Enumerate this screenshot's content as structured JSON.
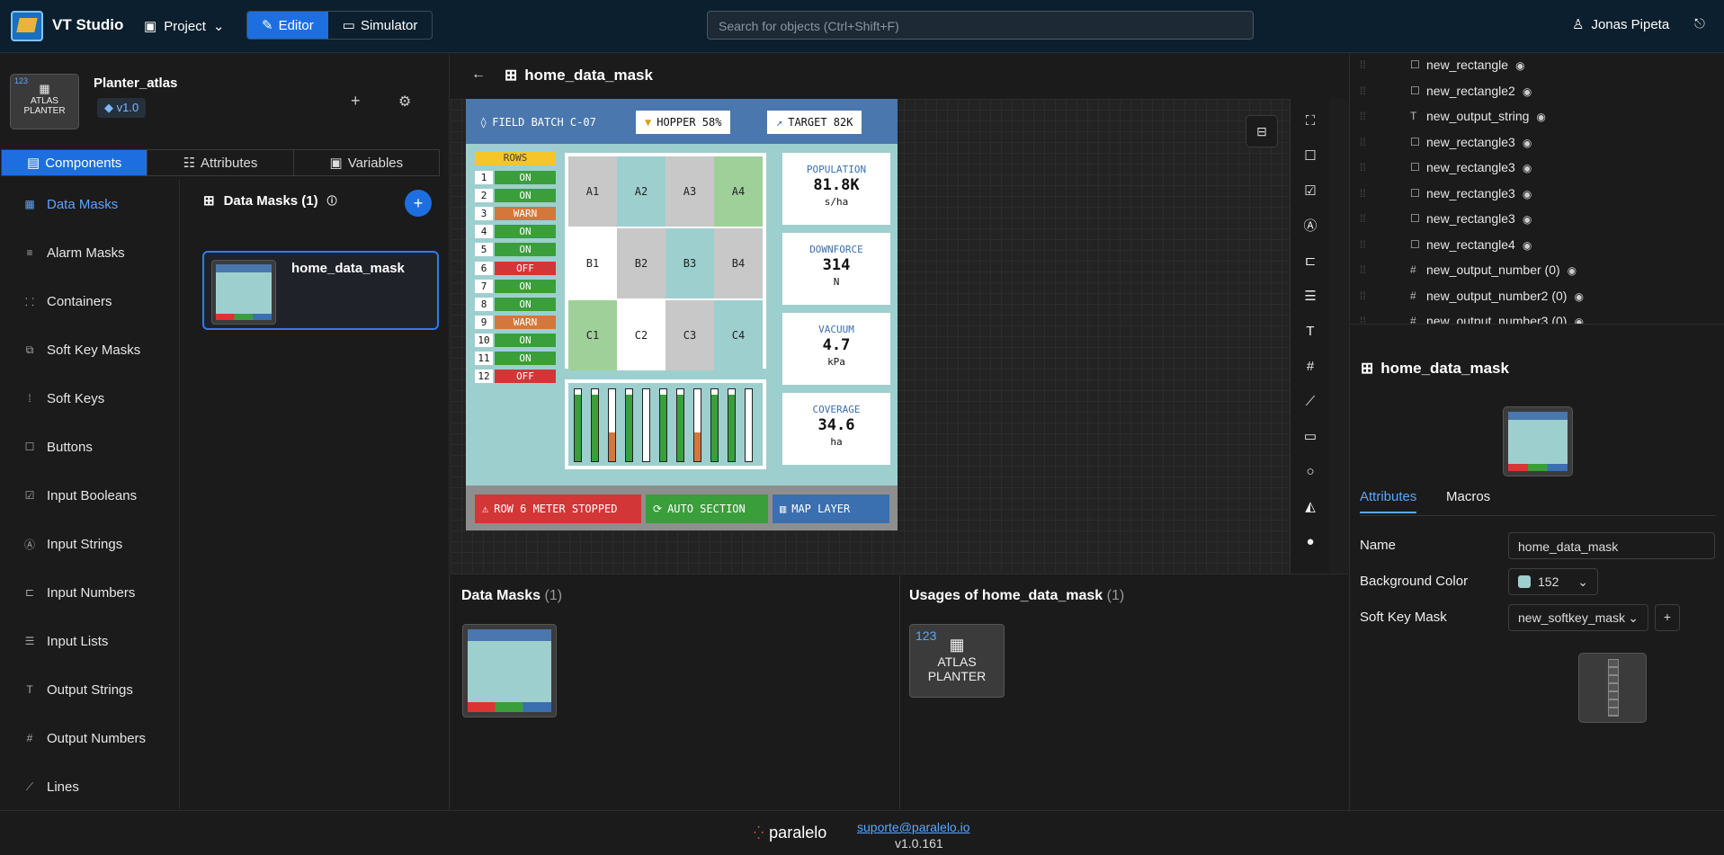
{
  "app": {
    "title": "VT Studio",
    "project_menu": "Project",
    "mode_editor": "Editor",
    "mode_simulator": "Simulator",
    "search_placeholder": "Search for objects (Ctrl+Shift+F)",
    "user": "Jonas Pipeta"
  },
  "project": {
    "name": "Planter_atlas",
    "version": "v1.0",
    "card_number": "123",
    "card_label_1": "ATLAS",
    "card_label_2": "PLANTER"
  },
  "left_tabs": [
    "Components",
    "Attributes",
    "Variables"
  ],
  "nav": [
    "Data Masks",
    "Alarm Masks",
    "Containers",
    "Soft Key Masks",
    "Soft Keys",
    "Buttons",
    "Input Booleans",
    "Input Strings",
    "Input Numbers",
    "Input Lists",
    "Output Strings",
    "Output Numbers",
    "Lines"
  ],
  "nav_icons": [
    "▦",
    "≡",
    "⸬",
    "⧉",
    "⁞",
    "☐",
    "☑",
    "Ⓐ",
    "⊏",
    "☰",
    "T",
    "#",
    "⟋"
  ],
  "list": {
    "heading": "Data Masks (1)",
    "item": "home_data_mask"
  },
  "center": {
    "title": "home_data_mask"
  },
  "vt": {
    "header": [
      "FIELD BATCH C-07",
      "HOPPER 58%",
      "TARGET 82K"
    ],
    "rows_title": "ROWS",
    "rows": [
      {
        "n": "1",
        "s": "ON"
      },
      {
        "n": "2",
        "s": "ON"
      },
      {
        "n": "3",
        "s": "WARN"
      },
      {
        "n": "4",
        "s": "ON"
      },
      {
        "n": "5",
        "s": "ON"
      },
      {
        "n": "6",
        "s": "OFF"
      },
      {
        "n": "7",
        "s": "ON"
      },
      {
        "n": "8",
        "s": "ON"
      },
      {
        "n": "9",
        "s": "WARN"
      },
      {
        "n": "10",
        "s": "ON"
      },
      {
        "n": "11",
        "s": "ON"
      },
      {
        "n": "12",
        "s": "OFF"
      }
    ],
    "status_colors": {
      "ON": "#3a9e3a",
      "WARN": "#d4773a",
      "OFF": "#d33636"
    },
    "cells": [
      {
        "id": "A1",
        "c": "#c8c8c8"
      },
      {
        "id": "A2",
        "c": "#9ecfcf"
      },
      {
        "id": "A3",
        "c": "#c8c8c8"
      },
      {
        "id": "A4",
        "c": "#9fd09a"
      },
      {
        "id": "B1",
        "c": "#ffffff"
      },
      {
        "id": "B2",
        "c": "#c8c8c8"
      },
      {
        "id": "B3",
        "c": "#9ecfcf"
      },
      {
        "id": "B4",
        "c": "#c8c8c8"
      },
      {
        "id": "C1",
        "c": "#9fd09a"
      },
      {
        "id": "C2",
        "c": "#ffffff"
      },
      {
        "id": "C3",
        "c": "#c8c8c8"
      },
      {
        "id": "C4",
        "c": "#9ecfcf"
      }
    ],
    "bar_levels": [
      0.92,
      0.92,
      0.4,
      0.92,
      0,
      0.92,
      0.92,
      0.4,
      0.92,
      0.92,
      0
    ],
    "bar_colors": [
      "#3a9e3a",
      "#3a9e3a",
      "#d4773a",
      "#3a9e3a",
      "#3a9e3a",
      "#3a9e3a",
      "#3a9e3a",
      "#d4773a",
      "#3a9e3a",
      "#3a9e3a",
      "#3a9e3a"
    ],
    "stats": [
      {
        "label": "POPULATION",
        "value": "81.8K",
        "unit": "s/ha"
      },
      {
        "label": "DOWNFORCE",
        "value": "314",
        "unit": "N"
      },
      {
        "label": "VACUUM",
        "value": "4.7",
        "unit": "kPa"
      },
      {
        "label": "COVERAGE",
        "value": "34.6",
        "unit": "ha"
      }
    ],
    "footer": [
      "ROW 6 METER STOPPED",
      "AUTO SECTION",
      "MAP LAYER"
    ]
  },
  "bottom": {
    "left_heading": "Data Masks",
    "left_count": "(1)",
    "right_heading": "Usages of home_data_mask",
    "right_count": "(1)",
    "usage_number": "123",
    "usage_label_1": "ATLAS",
    "usage_label_2": "PLANTER"
  },
  "tree": [
    {
      "t": "☐",
      "l": "new_rectangle"
    },
    {
      "t": "☐",
      "l": "new_rectangle2"
    },
    {
      "t": "T",
      "l": "new_output_string"
    },
    {
      "t": "☐",
      "l": "new_rectangle3"
    },
    {
      "t": "☐",
      "l": "new_rectangle3"
    },
    {
      "t": "☐",
      "l": "new_rectangle3"
    },
    {
      "t": "☐",
      "l": "new_rectangle3"
    },
    {
      "t": "☐",
      "l": "new_rectangle4"
    },
    {
      "t": "#",
      "l": "new_output_number (0)"
    },
    {
      "t": "#",
      "l": "new_output_number2 (0)"
    },
    {
      "t": "#",
      "l": "new_output_number3 (0)"
    }
  ],
  "props": {
    "title": "home_data_mask",
    "tab_attributes": "Attributes",
    "tab_macros": "Macros",
    "name_label": "Name",
    "name_value": "home_data_mask",
    "bg_label": "Background Color",
    "bg_value": "152",
    "bg_swatch": "#9ecfcf",
    "skm_label": "Soft Key Mask",
    "skm_value": "new_softkey_mask"
  },
  "footer": {
    "brand": "paralelo",
    "email": "suporte@paralelo.io",
    "version": "v1.0.161"
  }
}
